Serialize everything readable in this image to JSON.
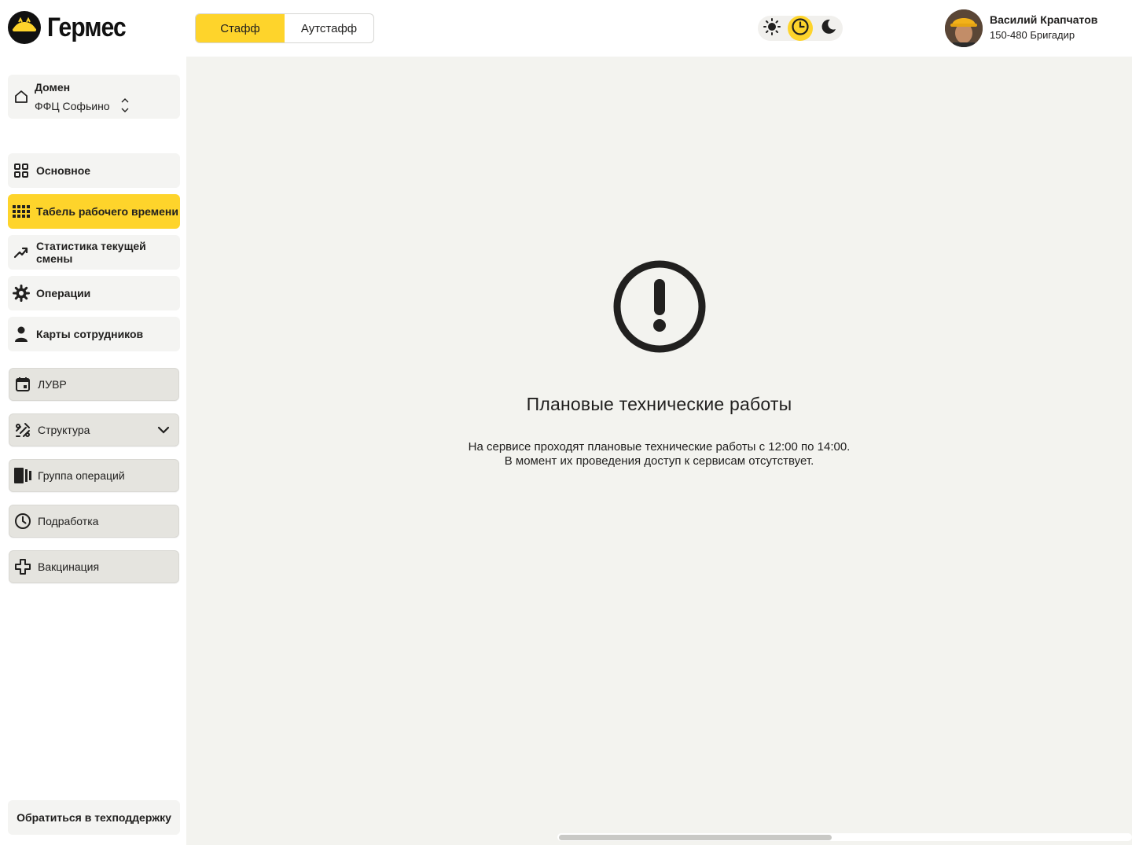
{
  "app": {
    "name": "Гермес"
  },
  "header": {
    "tabs": [
      {
        "label": "Стафф",
        "active": true
      },
      {
        "label": "Аутстафф",
        "active": false
      }
    ],
    "theme": {
      "options": [
        "sun-icon",
        "clock-icon",
        "moon-icon"
      ],
      "selected": "clock-icon"
    },
    "user": {
      "name": "Василий Крапчатов",
      "role": "150-480 Бригадир"
    }
  },
  "sidebar": {
    "domain": {
      "title": "Домен",
      "value": "ФФЦ Софьино"
    },
    "items": [
      {
        "label": "Основное",
        "icon": "dashboard-icon"
      },
      {
        "label": "Табель рабочего времени",
        "icon": "grid-icon",
        "active": true
      },
      {
        "label": "Статистика текущей смены",
        "icon": "trend-icon"
      },
      {
        "label": "Операции",
        "icon": "gear-icon"
      },
      {
        "label": "Карты сотрудников",
        "icon": "person-icon"
      }
    ],
    "secondary": [
      {
        "label": "ЛУВР",
        "icon": "calendar-icon"
      },
      {
        "label": "Структура",
        "icon": "structure-icon"
      },
      {
        "label": "Группа операций",
        "icon": "book-icon"
      },
      {
        "label": "Подработка",
        "icon": "clock-icon"
      },
      {
        "label": "Вакцинация",
        "icon": "cross-icon"
      }
    ],
    "support": "Обратиться в техподдержку"
  },
  "main": {
    "title": "Плановые технические работы",
    "description_line1": "На сервисе проходят плановые технические работы с 12:00 по 14:00.",
    "description_line2": "В момент их проведения доступ к сервисам отсутствует."
  },
  "colors": {
    "accent": "#fed42b",
    "background": "#f3f3ef",
    "text": "#21201f"
  }
}
